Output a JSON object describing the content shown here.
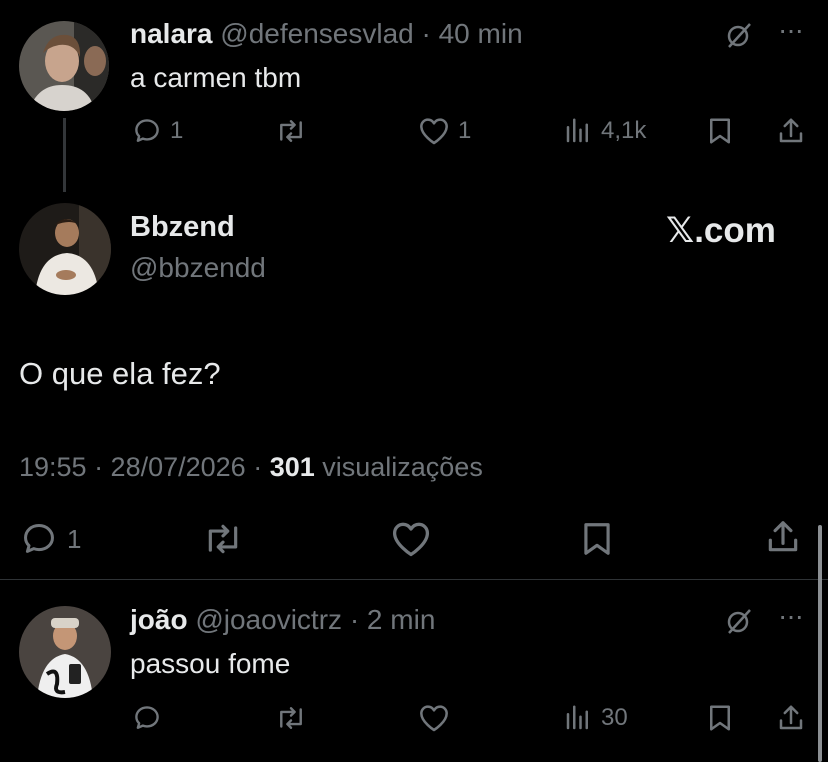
{
  "reply1": {
    "name": "nalara",
    "handle": "@defensesvlad",
    "sep": "·",
    "time": "40 min",
    "text": "a carmen tbm",
    "replies": "1",
    "likes": "1",
    "views": "4,1k"
  },
  "main": {
    "name": "Bbzend",
    "handle": "@bbzendd",
    "brand": "𝕏.com",
    "text": "O que ela fez?",
    "timestamp": "19:55 · 28/07/2026 · ",
    "views_count": "301",
    "views_label": " visualizações",
    "replies": "1"
  },
  "reply2": {
    "name": "joão",
    "handle": "@joaovictrz",
    "sep": "·",
    "time": "2 min",
    "text": "passou fome",
    "views": "30"
  },
  "more_glyph": "···",
  "grok_glyph": "⌀"
}
